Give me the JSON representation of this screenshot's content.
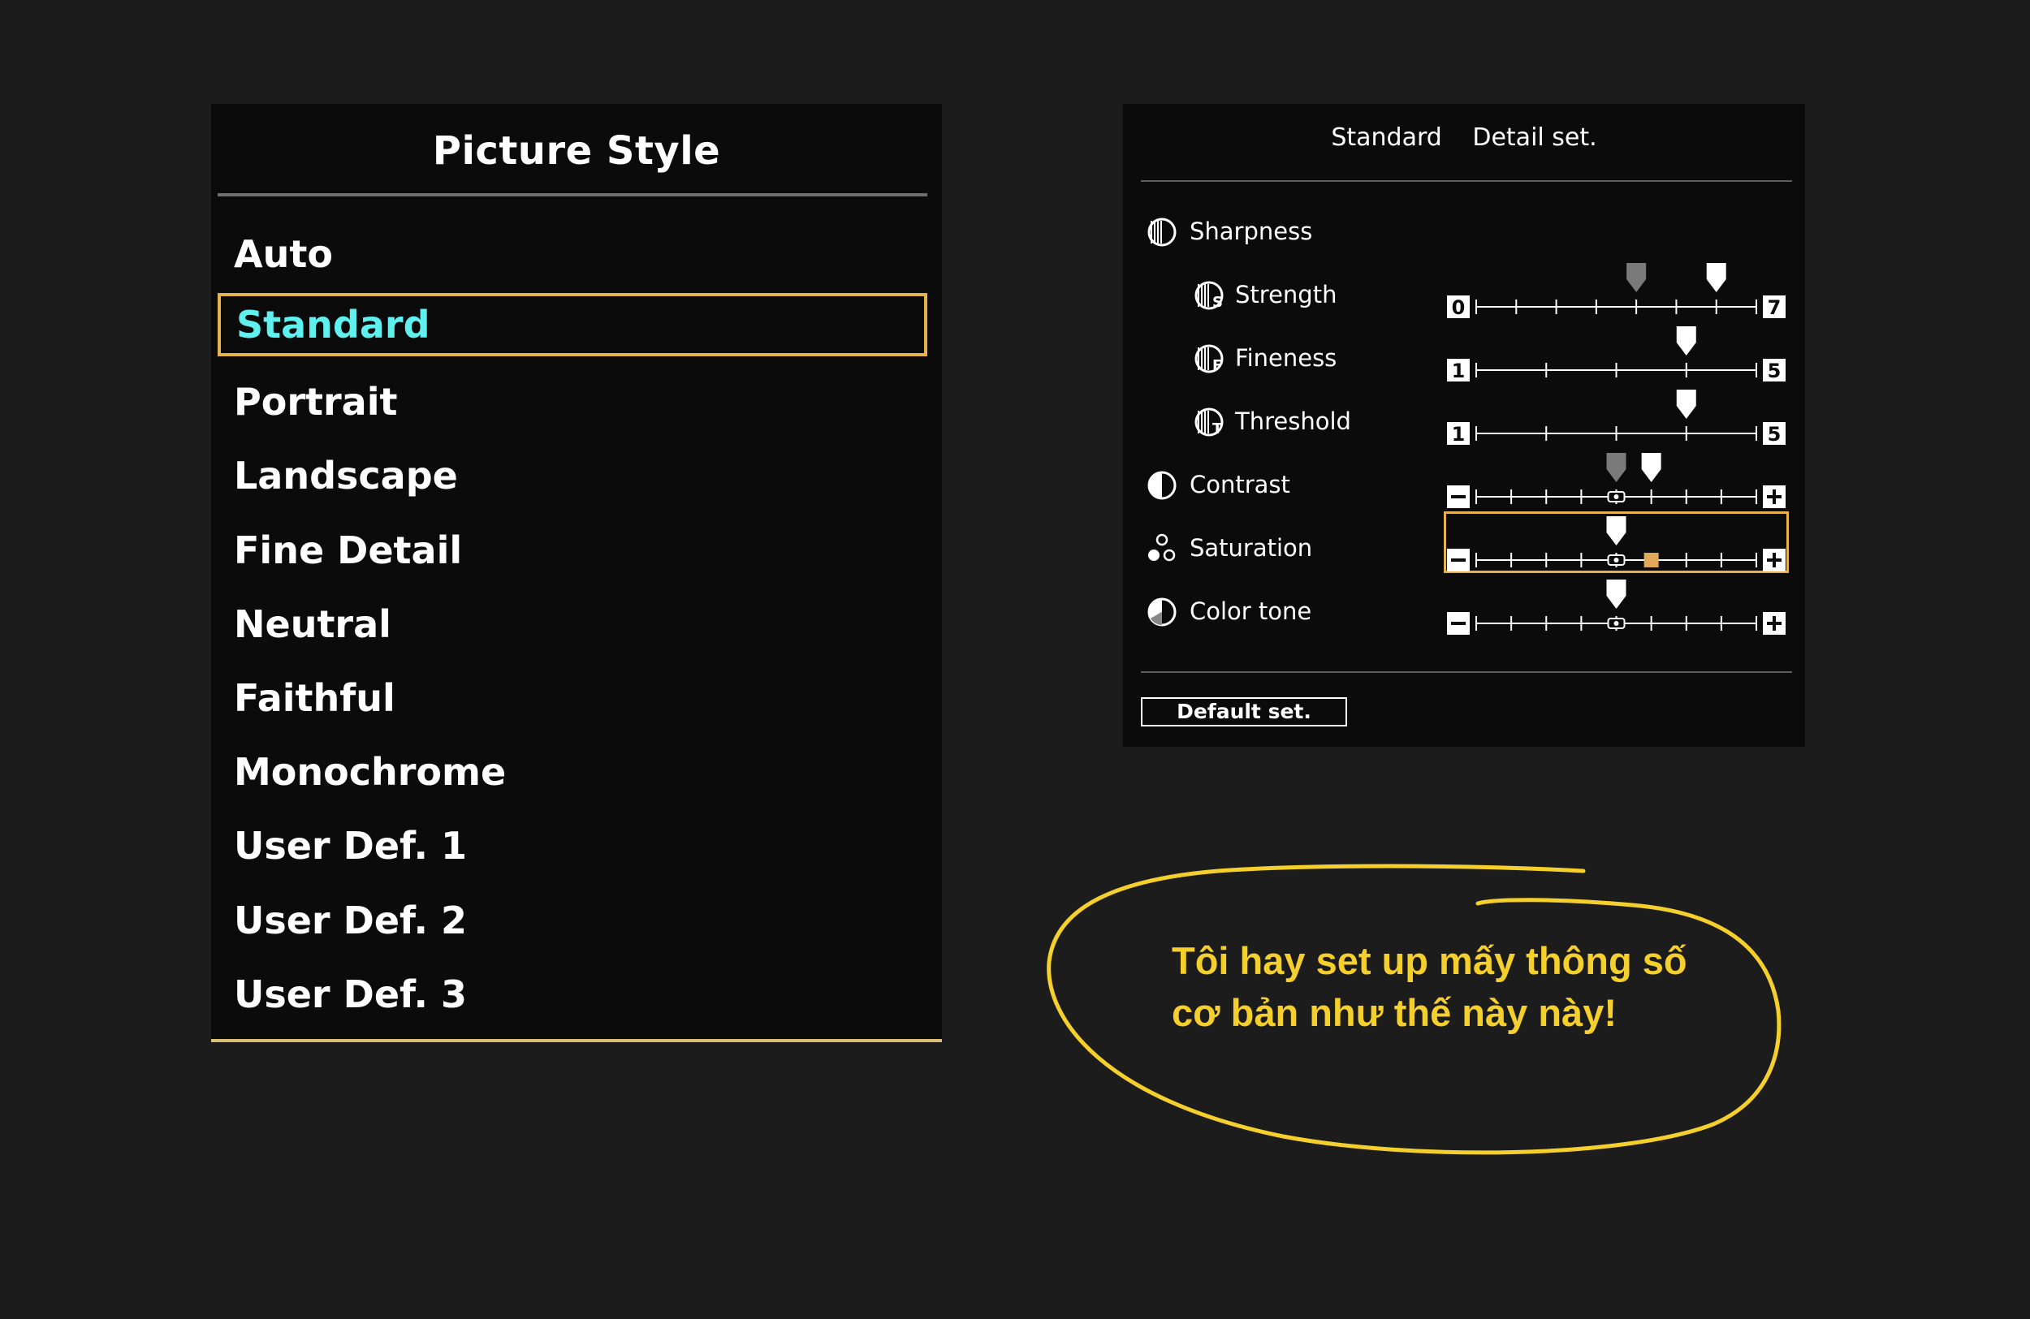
{
  "picture_style": {
    "title": "Picture Style",
    "items": [
      {
        "label": "Auto",
        "selected": false
      },
      {
        "label": "Standard",
        "selected": true
      },
      {
        "label": "Portrait",
        "selected": false
      },
      {
        "label": "Landscape",
        "selected": false
      },
      {
        "label": "Fine Detail",
        "selected": false
      },
      {
        "label": "Neutral",
        "selected": false
      },
      {
        "label": "Faithful",
        "selected": false
      },
      {
        "label": "Monochrome",
        "selected": false
      },
      {
        "label": "User Def. 1",
        "selected": false
      },
      {
        "label": "User Def. 2",
        "selected": false
      },
      {
        "label": "User Def. 3",
        "selected": false
      }
    ]
  },
  "detail_set": {
    "style_name": "Standard",
    "title": "Detail set.",
    "rows": [
      {
        "label": "Sharpness",
        "icon": "sharpness-icon",
        "indent": false,
        "slider": null
      },
      {
        "label": "Strength",
        "icon": "strength-icon",
        "indent": true,
        "slider": {
          "min_label": "0",
          "max_label": "7",
          "steps": 7,
          "value": 6,
          "default": 4,
          "center_mark": false
        }
      },
      {
        "label": "Fineness",
        "icon": "fineness-icon",
        "indent": true,
        "slider": {
          "min_label": "1",
          "max_label": "5",
          "steps": 4,
          "value": 4,
          "default": null,
          "center_mark": false
        }
      },
      {
        "label": "Threshold",
        "icon": "threshold-icon",
        "indent": true,
        "slider": {
          "min_label": "1",
          "max_label": "5",
          "steps": 4,
          "value": 4,
          "default": null,
          "center_mark": false
        }
      },
      {
        "label": "Contrast",
        "icon": "contrast-icon",
        "indent": false,
        "slider": {
          "min_label": "-",
          "max_label": "+",
          "steps": 8,
          "value": 1,
          "default": 0,
          "center_mark": true
        }
      },
      {
        "label": "Saturation",
        "icon": "saturation-icon",
        "indent": false,
        "slider": {
          "min_label": "-",
          "max_label": "+",
          "steps": 8,
          "value": 0,
          "default": null,
          "center_mark": true,
          "cursor": 1,
          "active": true
        }
      },
      {
        "label": "Color tone",
        "icon": "color-tone-icon",
        "indent": false,
        "slider": {
          "min_label": "-",
          "max_label": "+",
          "steps": 8,
          "value": 0,
          "default": null,
          "center_mark": true
        }
      }
    ],
    "default_button": "Default set."
  },
  "note": {
    "lines": [
      "Tôi hay set up mấy thông số",
      "cơ bản như thế này này!"
    ],
    "color": "#f5cf2b"
  },
  "colors": {
    "highlight_border": "#e5b24d",
    "selected_text": "#5ff0f0",
    "saturation_cursor": "#e0a858"
  }
}
